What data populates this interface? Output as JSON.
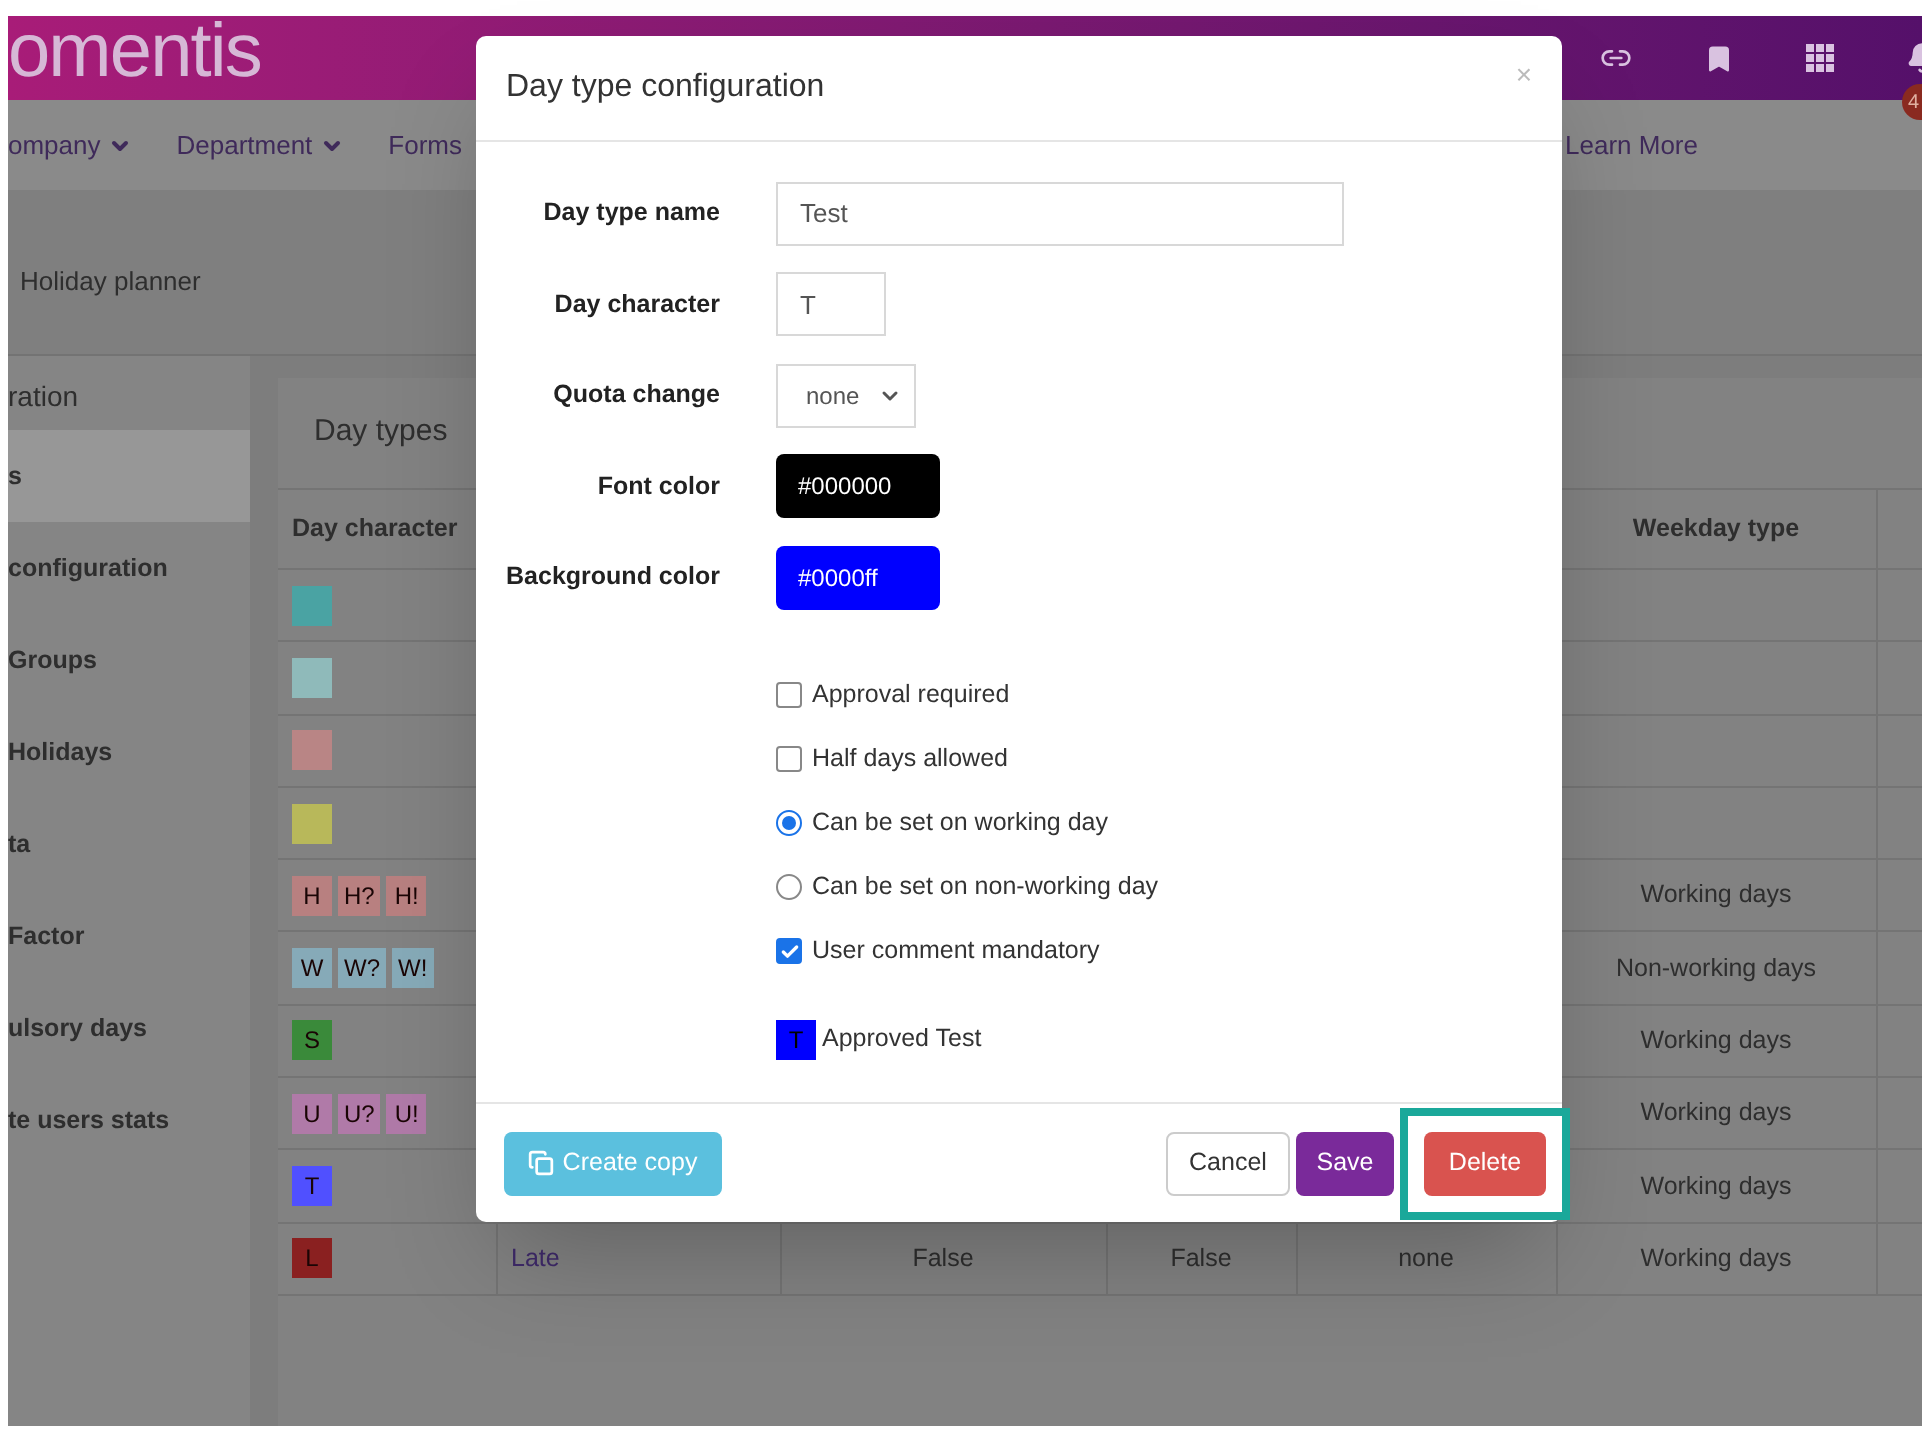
{
  "header": {
    "logo": "omentis",
    "badge": "4"
  },
  "nav": [
    {
      "label": "ompany",
      "dropdown": true
    },
    {
      "label": "Department",
      "dropdown": true
    },
    {
      "label": "Forms",
      "dropdown": false
    },
    {
      "label": "Learn More",
      "dropdown": false
    }
  ],
  "breadcrumb": "Holiday planner",
  "sidebar": {
    "title": "ration",
    "items": [
      {
        "label": "s",
        "selected": true
      },
      {
        "label": "configuration",
        "selected": false
      },
      {
        "label": "Groups",
        "selected": false
      },
      {
        "label": "Holidays",
        "selected": false
      },
      {
        "label": "ta",
        "selected": false
      },
      {
        "label": "Factor",
        "selected": false
      },
      {
        "label": "ulsory days",
        "selected": false
      },
      {
        "label": "te users stats",
        "selected": false
      }
    ]
  },
  "card": {
    "title": "Day types",
    "columns": [
      "Day character",
      "Weekday type"
    ],
    "rows": [
      {
        "chips": [
          {
            "color": "#4aa3a3"
          }
        ]
      },
      {
        "chips": [
          {
            "color": "#8fbaba"
          }
        ]
      },
      {
        "chips": [
          {
            "color": "#b98585"
          }
        ]
      },
      {
        "chips": [
          {
            "color": "#b8b85a"
          }
        ]
      },
      {
        "chips": [
          {
            "text": "H",
            "color": "#b88080"
          },
          {
            "text": "H?",
            "color": "#b88080"
          },
          {
            "text": "H!",
            "color": "#b88080"
          }
        ],
        "weekday_type": "Working days"
      },
      {
        "chips": [
          {
            "text": "W",
            "color": "#86aab8"
          },
          {
            "text": "W?",
            "color": "#86aab8"
          },
          {
            "text": "W!",
            "color": "#86aab8"
          }
        ],
        "weekday_type": "Non-working days"
      },
      {
        "chips": [
          {
            "text": "S",
            "color": "#3a8a3a"
          }
        ],
        "weekday_type": "Working days"
      },
      {
        "chips": [
          {
            "text": "U",
            "color": "#b07aa8"
          },
          {
            "text": "U?",
            "color": "#b07aa8"
          },
          {
            "text": "U!",
            "color": "#b07aa8"
          }
        ],
        "weekday_type": "Working days"
      },
      {
        "chips": [
          {
            "text": "T",
            "color": "#5050ff"
          }
        ],
        "weekday_type": "Working days"
      },
      {
        "chips": [
          {
            "text": "L",
            "color": "#8a2020"
          }
        ],
        "cells": [
          "Late",
          "False",
          "False",
          "none"
        ],
        "weekday_type": "Working days"
      }
    ]
  },
  "modal": {
    "title": "Day type configuration",
    "close": "×",
    "fields": [
      {
        "label": "Day type name",
        "kind": "text",
        "value": "Test"
      },
      {
        "label": "Day character",
        "kind": "char",
        "value": "T"
      },
      {
        "label": "Quota change",
        "kind": "select",
        "value": "none"
      },
      {
        "label": "Font color",
        "kind": "color",
        "value": "#000000",
        "color": "#000000"
      },
      {
        "label": "Background color",
        "kind": "color",
        "value": "#0000ff",
        "color": "#0000ff"
      }
    ],
    "options": [
      {
        "kind": "checkbox",
        "label": "Approval required",
        "checked": false
      },
      {
        "kind": "checkbox",
        "label": "Half days allowed",
        "checked": false
      },
      {
        "kind": "radio",
        "label": "Can be set on working day",
        "selected": true
      },
      {
        "kind": "radio",
        "label": "Can be set on non-working day",
        "selected": false
      },
      {
        "kind": "checkbox",
        "label": "User comment mandatory",
        "checked": true
      }
    ],
    "preview": {
      "character": "T",
      "label": "Approved Test",
      "color": "#0000ff"
    },
    "buttons": [
      {
        "kind": "copy",
        "label": "Create copy",
        "highlighted": false
      },
      {
        "kind": "cancel",
        "label": "Cancel",
        "highlighted": false
      },
      {
        "kind": "save",
        "label": "Save",
        "highlighted": false
      },
      {
        "kind": "delete",
        "label": "Delete",
        "highlighted": true
      }
    ]
  }
}
